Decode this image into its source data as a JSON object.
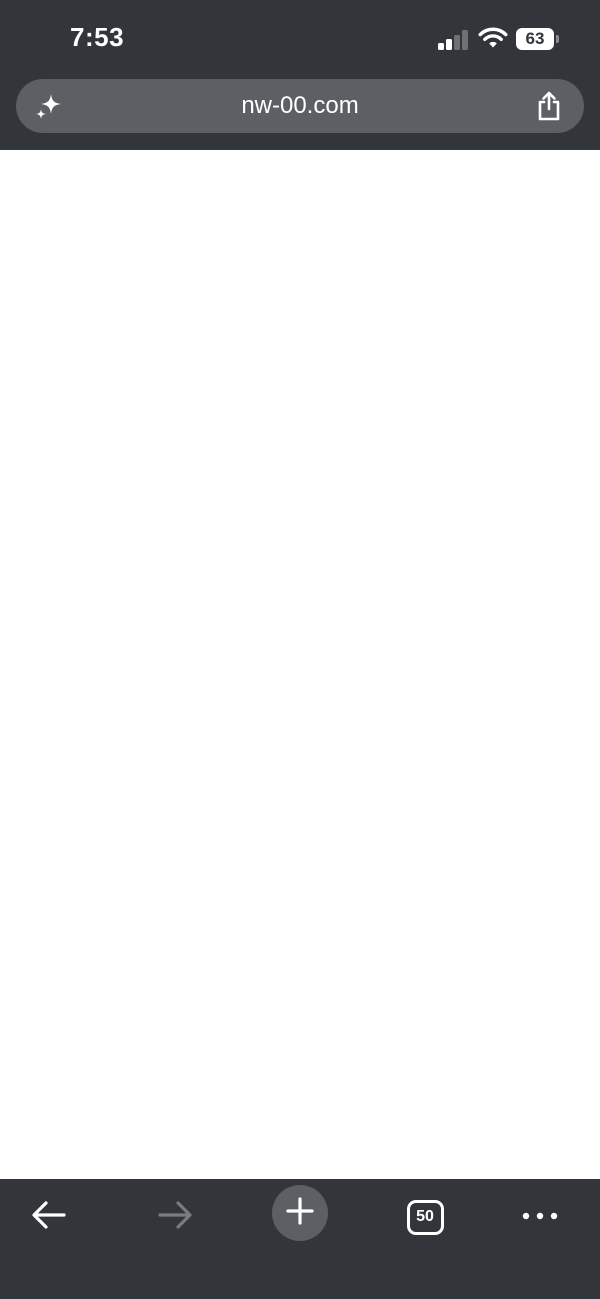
{
  "status_bar": {
    "time": "7:53",
    "battery_level": "63",
    "signal_icon": "cellular-signal-icon",
    "wifi_icon": "wifi-icon",
    "battery_icon": "battery-icon"
  },
  "address_bar": {
    "url": "nw-00.com",
    "left_icon": "sparkle-ai-icon",
    "right_icon": "share-icon"
  },
  "toolbar": {
    "back_icon": "arrow-left-icon",
    "forward_icon": "arrow-right-icon",
    "new_tab_icon": "plus-icon",
    "tab_count": "50",
    "more_icon": "more-horizontal-icon"
  },
  "colors": {
    "chrome_background": "#323539",
    "address_bar_background": "#5c6064",
    "content_background": "#ffffff",
    "icon_active": "#ffffff",
    "icon_disabled": "#7a7d80"
  }
}
